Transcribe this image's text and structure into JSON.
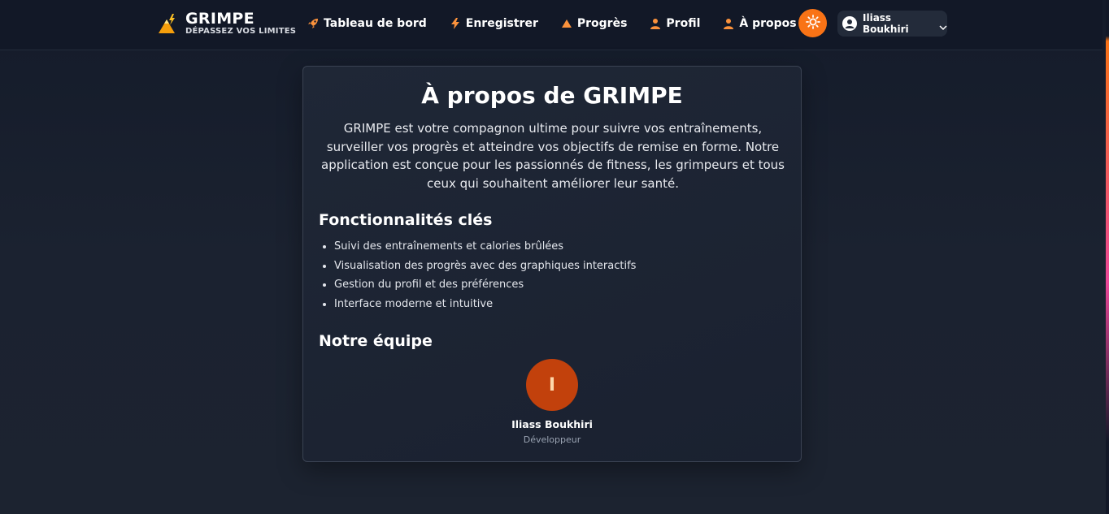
{
  "brand": {
    "title": "GRIMPE",
    "tagline": "DÉPASSEZ VOS LIMITES",
    "logo_icon": "mountain-bolt-icon"
  },
  "nav": {
    "items": [
      {
        "label": "Tableau de bord",
        "icon": "rocket-icon"
      },
      {
        "label": "Enregistrer",
        "icon": "bolt-icon"
      },
      {
        "label": "Progrès",
        "icon": "mountain-icon"
      },
      {
        "label": "Profil",
        "icon": "user-icon"
      },
      {
        "label": "À propos",
        "icon": "user-icon"
      }
    ]
  },
  "header": {
    "theme_icon": "sun-icon",
    "user_name": "Iliass Boukhiri"
  },
  "about": {
    "title": "À propos de GRIMPE",
    "intro": "GRIMPE est votre compagnon ultime pour suivre vos entraînements, surveiller vos progrès et atteindre vos objectifs de remise en forme. Notre application est conçue pour les passionnés de fitness, les grimpeurs et tous ceux qui souhaitent améliorer leur santé.",
    "features_title": "Fonctionnalités clés",
    "features": [
      "Suivi des entraînements et calories brûlées",
      "Visualisation des progrès avec des graphiques interactifs",
      "Gestion du profil et des préférences",
      "Interface moderne et intuitive"
    ],
    "team_title": "Notre équipe",
    "team": [
      {
        "initial": "I",
        "name": "Iliass Boukhiri",
        "role": "Développeur"
      }
    ]
  },
  "colors": {
    "accent": "#f97316",
    "avatar_bg": "#c2410c",
    "background": "#1b2230"
  }
}
